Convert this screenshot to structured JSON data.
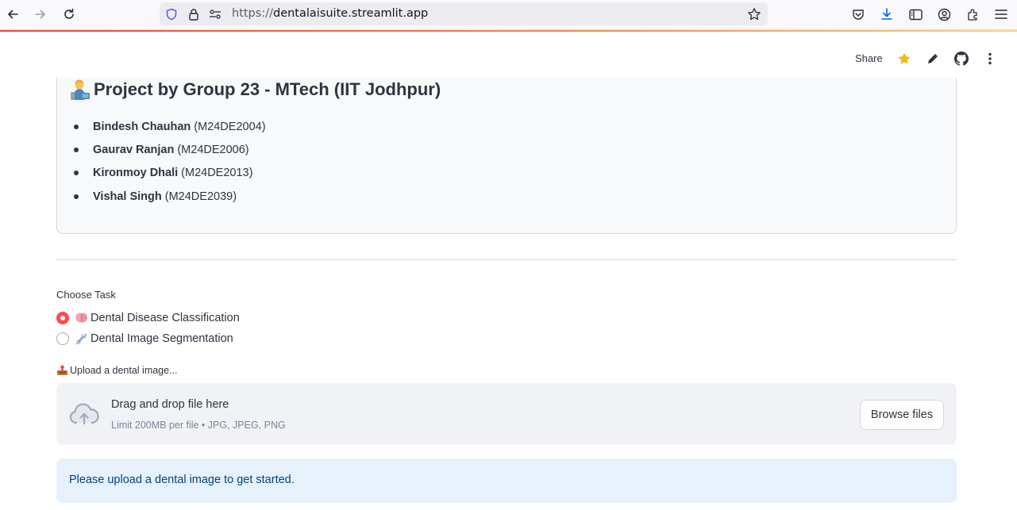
{
  "browser": {
    "url_scheme": "https://",
    "url_host": "dentalaisuite.streamlit.app",
    "icons": [
      "back-arrow-icon",
      "forward-arrow-icon",
      "reload-icon",
      "shield-icon",
      "lock-icon",
      "permissions-icon",
      "bookmark-star-icon",
      "pocket-icon",
      "download-icon",
      "sidebar-icon",
      "account-icon",
      "extensions-icon",
      "menu-icon"
    ]
  },
  "header": {
    "share_label": "Share",
    "icons": [
      "star-icon",
      "edit-pencil-icon",
      "github-icon",
      "more-vertical-icon"
    ],
    "accent": "#f5b915"
  },
  "project": {
    "title": "Project by Group 23 - MTech (IIT Jodhpur)",
    "title_icon": "technologist-emoji-icon",
    "members": [
      {
        "name": "Bindesh Chauhan",
        "id": "(M24DE2004)"
      },
      {
        "name": "Gaurav Ranjan",
        "id": "(M24DE2006)"
      },
      {
        "name": "Kironmoy Dhali",
        "id": "(M24DE2013)"
      },
      {
        "name": "Vishal Singh",
        "id": "(M24DE2039)"
      }
    ]
  },
  "task": {
    "label": "Choose Task",
    "options": [
      {
        "label": "Dental Disease Classification",
        "icon": "brain-emoji-icon",
        "checked": true
      },
      {
        "label": "Dental Image Segmentation",
        "icon": "dna-emoji-icon",
        "checked": false
      }
    ],
    "selected_color": "#ff4b4b"
  },
  "upload": {
    "label": "Upload a dental image...",
    "label_icon": "outbox-tray-emoji-icon",
    "drag_text": "Drag and drop file here",
    "limit_text": "Limit 200MB per file • JPG, JPEG, PNG",
    "browse_label": "Browse files",
    "icon": "cloud-upload-icon"
  },
  "info": {
    "message": "Please upload a dental image to get started."
  }
}
